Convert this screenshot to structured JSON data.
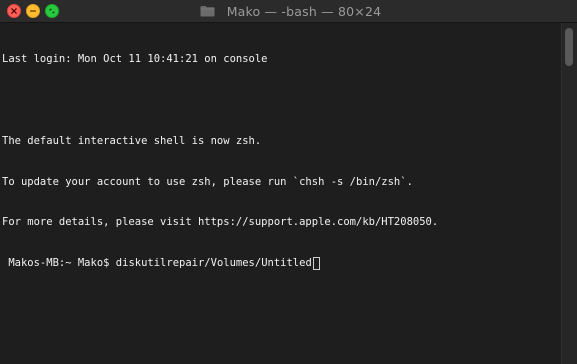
{
  "window": {
    "title": "Mako — -bash — 80×24",
    "buttons": {
      "close_icon": "close-icon",
      "minimize_icon": "minimize-icon",
      "maximize_icon": "maximize-icon"
    },
    "folder_icon": "folder-icon"
  },
  "terminal": {
    "lines": [
      "Last login: Mon Oct 11 10:41:21 on console",
      "",
      "The default interactive shell is now zsh.",
      "To update your account to use zsh, please run `chsh -s /bin/zsh`.",
      "For more details, please visit https://support.apple.com/kb/HT208050."
    ],
    "prompt": " Makos-MB:~ Mako$ ",
    "command": "diskutilrepair/Volumes/Untitled"
  },
  "colors": {
    "background": "#1e1e1e",
    "text": "#f2f2f2",
    "close": "#fe5f57",
    "minimize": "#febc2e",
    "maximize": "#28c840"
  }
}
